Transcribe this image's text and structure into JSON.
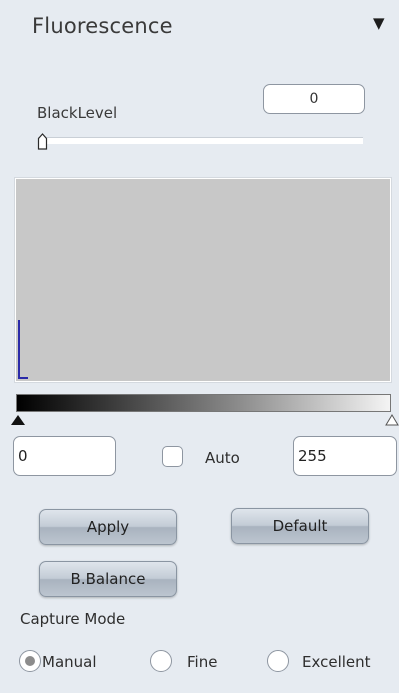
{
  "panel": {
    "title": "Fluorescence",
    "collapse_icon": "triangle-down-icon"
  },
  "black_level": {
    "label": "BlackLevel",
    "value": "0",
    "slider_fraction": 0.0
  },
  "histogram": {
    "background": "#c8c8c8",
    "line_color": "#2a2aa8"
  },
  "gradient": {
    "start_color": "#000000",
    "end_color": "#f4f4f4"
  },
  "range": {
    "min_value": "0",
    "max_value": "255",
    "auto_label": "Auto",
    "auto_checked": false
  },
  "buttons": {
    "apply": "Apply",
    "default": "Default",
    "b_balance": "B.Balance"
  },
  "capture": {
    "label": "Capture Mode",
    "options": [
      "Manual",
      "Fine",
      "Excellent"
    ],
    "selected": "Manual"
  }
}
